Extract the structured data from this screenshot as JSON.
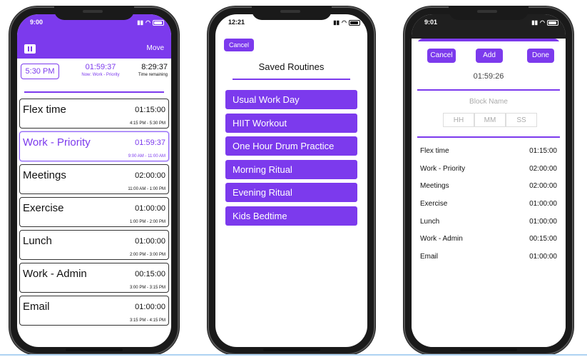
{
  "phone1": {
    "status_time": "9:00",
    "move_label": "Move",
    "current_time": "5:30 PM",
    "remaining": "01:59:37",
    "now_label": "Now: Work - Priority",
    "total": "8:29:37",
    "total_label": "Time remaining",
    "items": [
      {
        "name": "Flex time",
        "duration": "01:15:00",
        "range": "4:15 PM - 5:30 PM",
        "active": false
      },
      {
        "name": "Work - Priority",
        "duration": "01:59:37",
        "range": "9:00 AM - 11:00 AM",
        "active": true
      },
      {
        "name": "Meetings",
        "duration": "02:00:00",
        "range": "11:00 AM - 1:00 PM",
        "active": false
      },
      {
        "name": "Exercise",
        "duration": "01:00:00",
        "range": "1:00 PM - 2:00 PM",
        "active": false
      },
      {
        "name": "Lunch",
        "duration": "01:00:00",
        "range": "2:00 PM - 3:00 PM",
        "active": false
      },
      {
        "name": "Work - Admin",
        "duration": "00:15:00",
        "range": "3:00 PM - 3:15 PM",
        "active": false
      },
      {
        "name": "Email",
        "duration": "01:00:00",
        "range": "3:15 PM - 4:15 PM",
        "active": false
      }
    ]
  },
  "phone2": {
    "status_time": "12:21",
    "cancel_label": "Cancel",
    "title": "Saved Routines",
    "routines": [
      "Usual Work Day",
      "HIIT Workout",
      "One Hour Drum Practice",
      "Morning Ritual",
      "Evening Ritual",
      "Kids Bedtime"
    ]
  },
  "phone3": {
    "status_time": "9:01",
    "cancel_label": "Cancel",
    "add_label": "Add",
    "done_label": "Done",
    "total": "01:59:26",
    "block_name_placeholder": "Block Name",
    "hh_placeholder": "HH",
    "mm_placeholder": "MM",
    "ss_placeholder": "SS",
    "blocks": [
      {
        "name": "Flex time",
        "duration": "01:15:00"
      },
      {
        "name": "Work - Priority",
        "duration": "02:00:00"
      },
      {
        "name": "Meetings",
        "duration": "02:00:00"
      },
      {
        "name": "Exercise",
        "duration": "01:00:00"
      },
      {
        "name": "Lunch",
        "duration": "01:00:00"
      },
      {
        "name": "Work - Admin",
        "duration": "00:15:00"
      },
      {
        "name": "Email",
        "duration": "01:00:00"
      }
    ]
  },
  "colors": {
    "accent": "#7c3aed"
  }
}
